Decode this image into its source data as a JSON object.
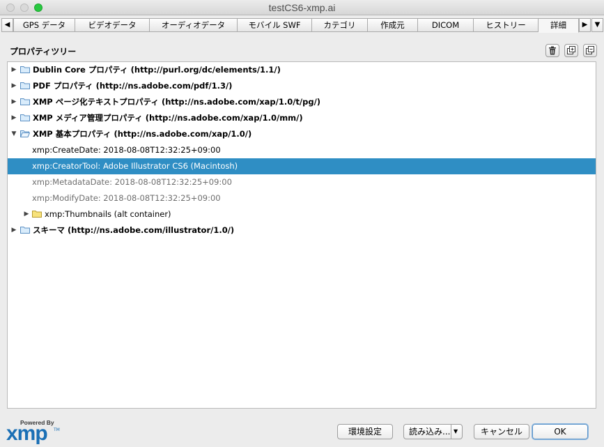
{
  "window": {
    "title": "testCS6-xmp.ai"
  },
  "tabs": [
    {
      "label": "GPS データ"
    },
    {
      "label": "ビデオデータ"
    },
    {
      "label": "オーディオデータ"
    },
    {
      "label": "モバイル SWF"
    },
    {
      "label": "カテゴリ"
    },
    {
      "label": "作成元"
    },
    {
      "label": "DICOM"
    },
    {
      "label": "ヒストリー"
    },
    {
      "label": "詳細"
    }
  ],
  "tab_arrows": {
    "left": "◀",
    "right": "▶",
    "menu": "▼"
  },
  "active_tab": "詳細",
  "panel": {
    "heading": "プロパティツリー"
  },
  "tree": [
    {
      "label": "Dublin Core プロパティ (http://purl.org/dc/elements/1.1/)",
      "expanded": false
    },
    {
      "label": "PDF プロパティ (http://ns.adobe.com/pdf/1.3/)",
      "expanded": false
    },
    {
      "label": "XMP ページ化テキストプロパティ (http://ns.adobe.com/xap/1.0/t/pg/)",
      "expanded": false
    },
    {
      "label": "XMP メディア管理プロパティ (http://ns.adobe.com/xap/1.0/mm/)",
      "expanded": false
    },
    {
      "label": "XMP 基本プロパティ (http://ns.adobe.com/xap/1.0/)",
      "expanded": true
    },
    {
      "label": "xmp:CreateDate: 2018-08-08T12:32:25+09:00"
    },
    {
      "label": "xmp:CreatorTool: Adobe Illustrator CS6 (Macintosh)",
      "selected": true
    },
    {
      "label": "xmp:MetadataDate: 2018-08-08T12:32:25+09:00"
    },
    {
      "label": "xmp:ModifyDate: 2018-08-08T12:32:25+09:00"
    },
    {
      "label": "xmp:Thumbnails (alt container)",
      "expanded": false
    },
    {
      "label": "スキーマ (http://ns.adobe.com/illustrator/1.0/)",
      "expanded": false
    }
  ],
  "logo": {
    "powered_by": "Powered By",
    "wordmark": "xmp",
    "tm": "TM"
  },
  "buttons": {
    "preferences": "環境設定",
    "load": "読み込み...",
    "load_menu": "▼",
    "cancel": "キャンセル",
    "ok": "OK"
  },
  "colors": {
    "selection": "#2f8ec4",
    "accent": "#1a6fb5"
  }
}
